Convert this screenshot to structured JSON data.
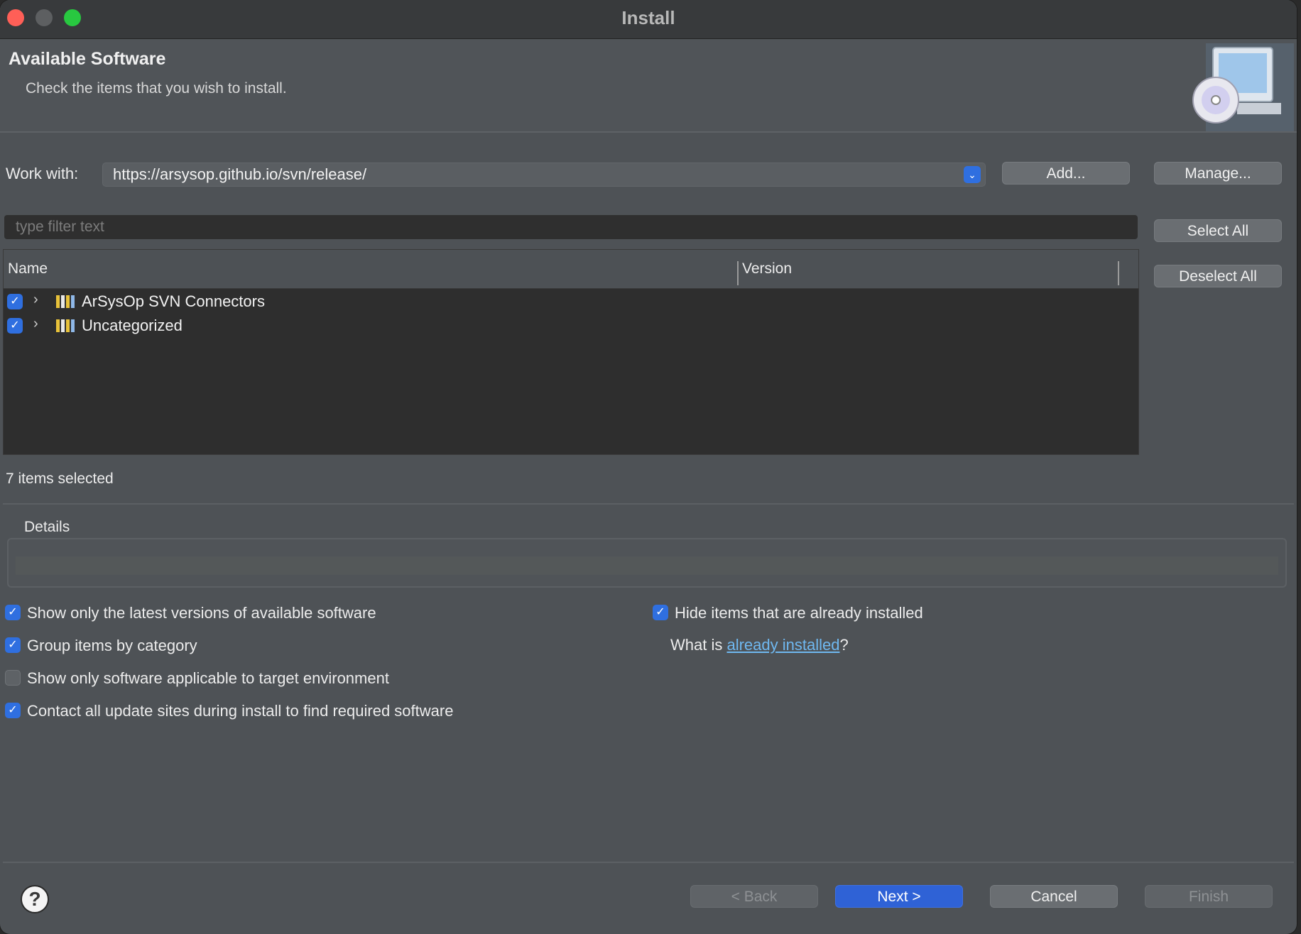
{
  "window": {
    "title": "Install"
  },
  "header": {
    "title": "Available Software",
    "description": "Check the items that you wish to install."
  },
  "work_with": {
    "label": "Work with:",
    "value": "https://arsysop.github.io/svn/release/",
    "add_label": "Add...",
    "manage_label": "Manage..."
  },
  "filter": {
    "placeholder": "type filter text"
  },
  "table": {
    "columns": [
      "Name",
      "Version"
    ],
    "rows": [
      {
        "name": "ArSysOp SVN Connectors",
        "checked": true
      },
      {
        "name": "Uncategorized",
        "checked": true
      }
    ]
  },
  "side_buttons": {
    "select_all": "Select All",
    "deselect_all": "Deselect All"
  },
  "status": {
    "selected_count": "7 items selected"
  },
  "details": {
    "label": "Details"
  },
  "options": {
    "latest_versions": {
      "label": "Show only the latest versions of available software",
      "checked": true
    },
    "group_by_category": {
      "label": "Group items by category",
      "checked": true
    },
    "target_env": {
      "label": "Show only software applicable to target environment",
      "checked": false
    },
    "contact_sites": {
      "label": "Contact all update sites during install to find required software",
      "checked": true
    },
    "hide_installed": {
      "label": "Hide items that are already installed",
      "checked": true
    },
    "what_is_prefix": "What is ",
    "what_is_link": "already installed",
    "what_is_suffix": "?"
  },
  "footer": {
    "back": "< Back",
    "next": "Next >",
    "cancel": "Cancel",
    "finish": "Finish",
    "help": "?"
  },
  "colors": {
    "accent": "#2f6fe0",
    "primary_button": "#2f62d6",
    "link": "#6fb8f0"
  },
  "icons": {
    "checkbox_checked": "checkmark-icon",
    "tree_expand": "chevron-right-icon",
    "category": "category-icon",
    "combo": "chevron-down-icon",
    "banner": "install-cd-monitor-icon",
    "help": "help-icon"
  }
}
